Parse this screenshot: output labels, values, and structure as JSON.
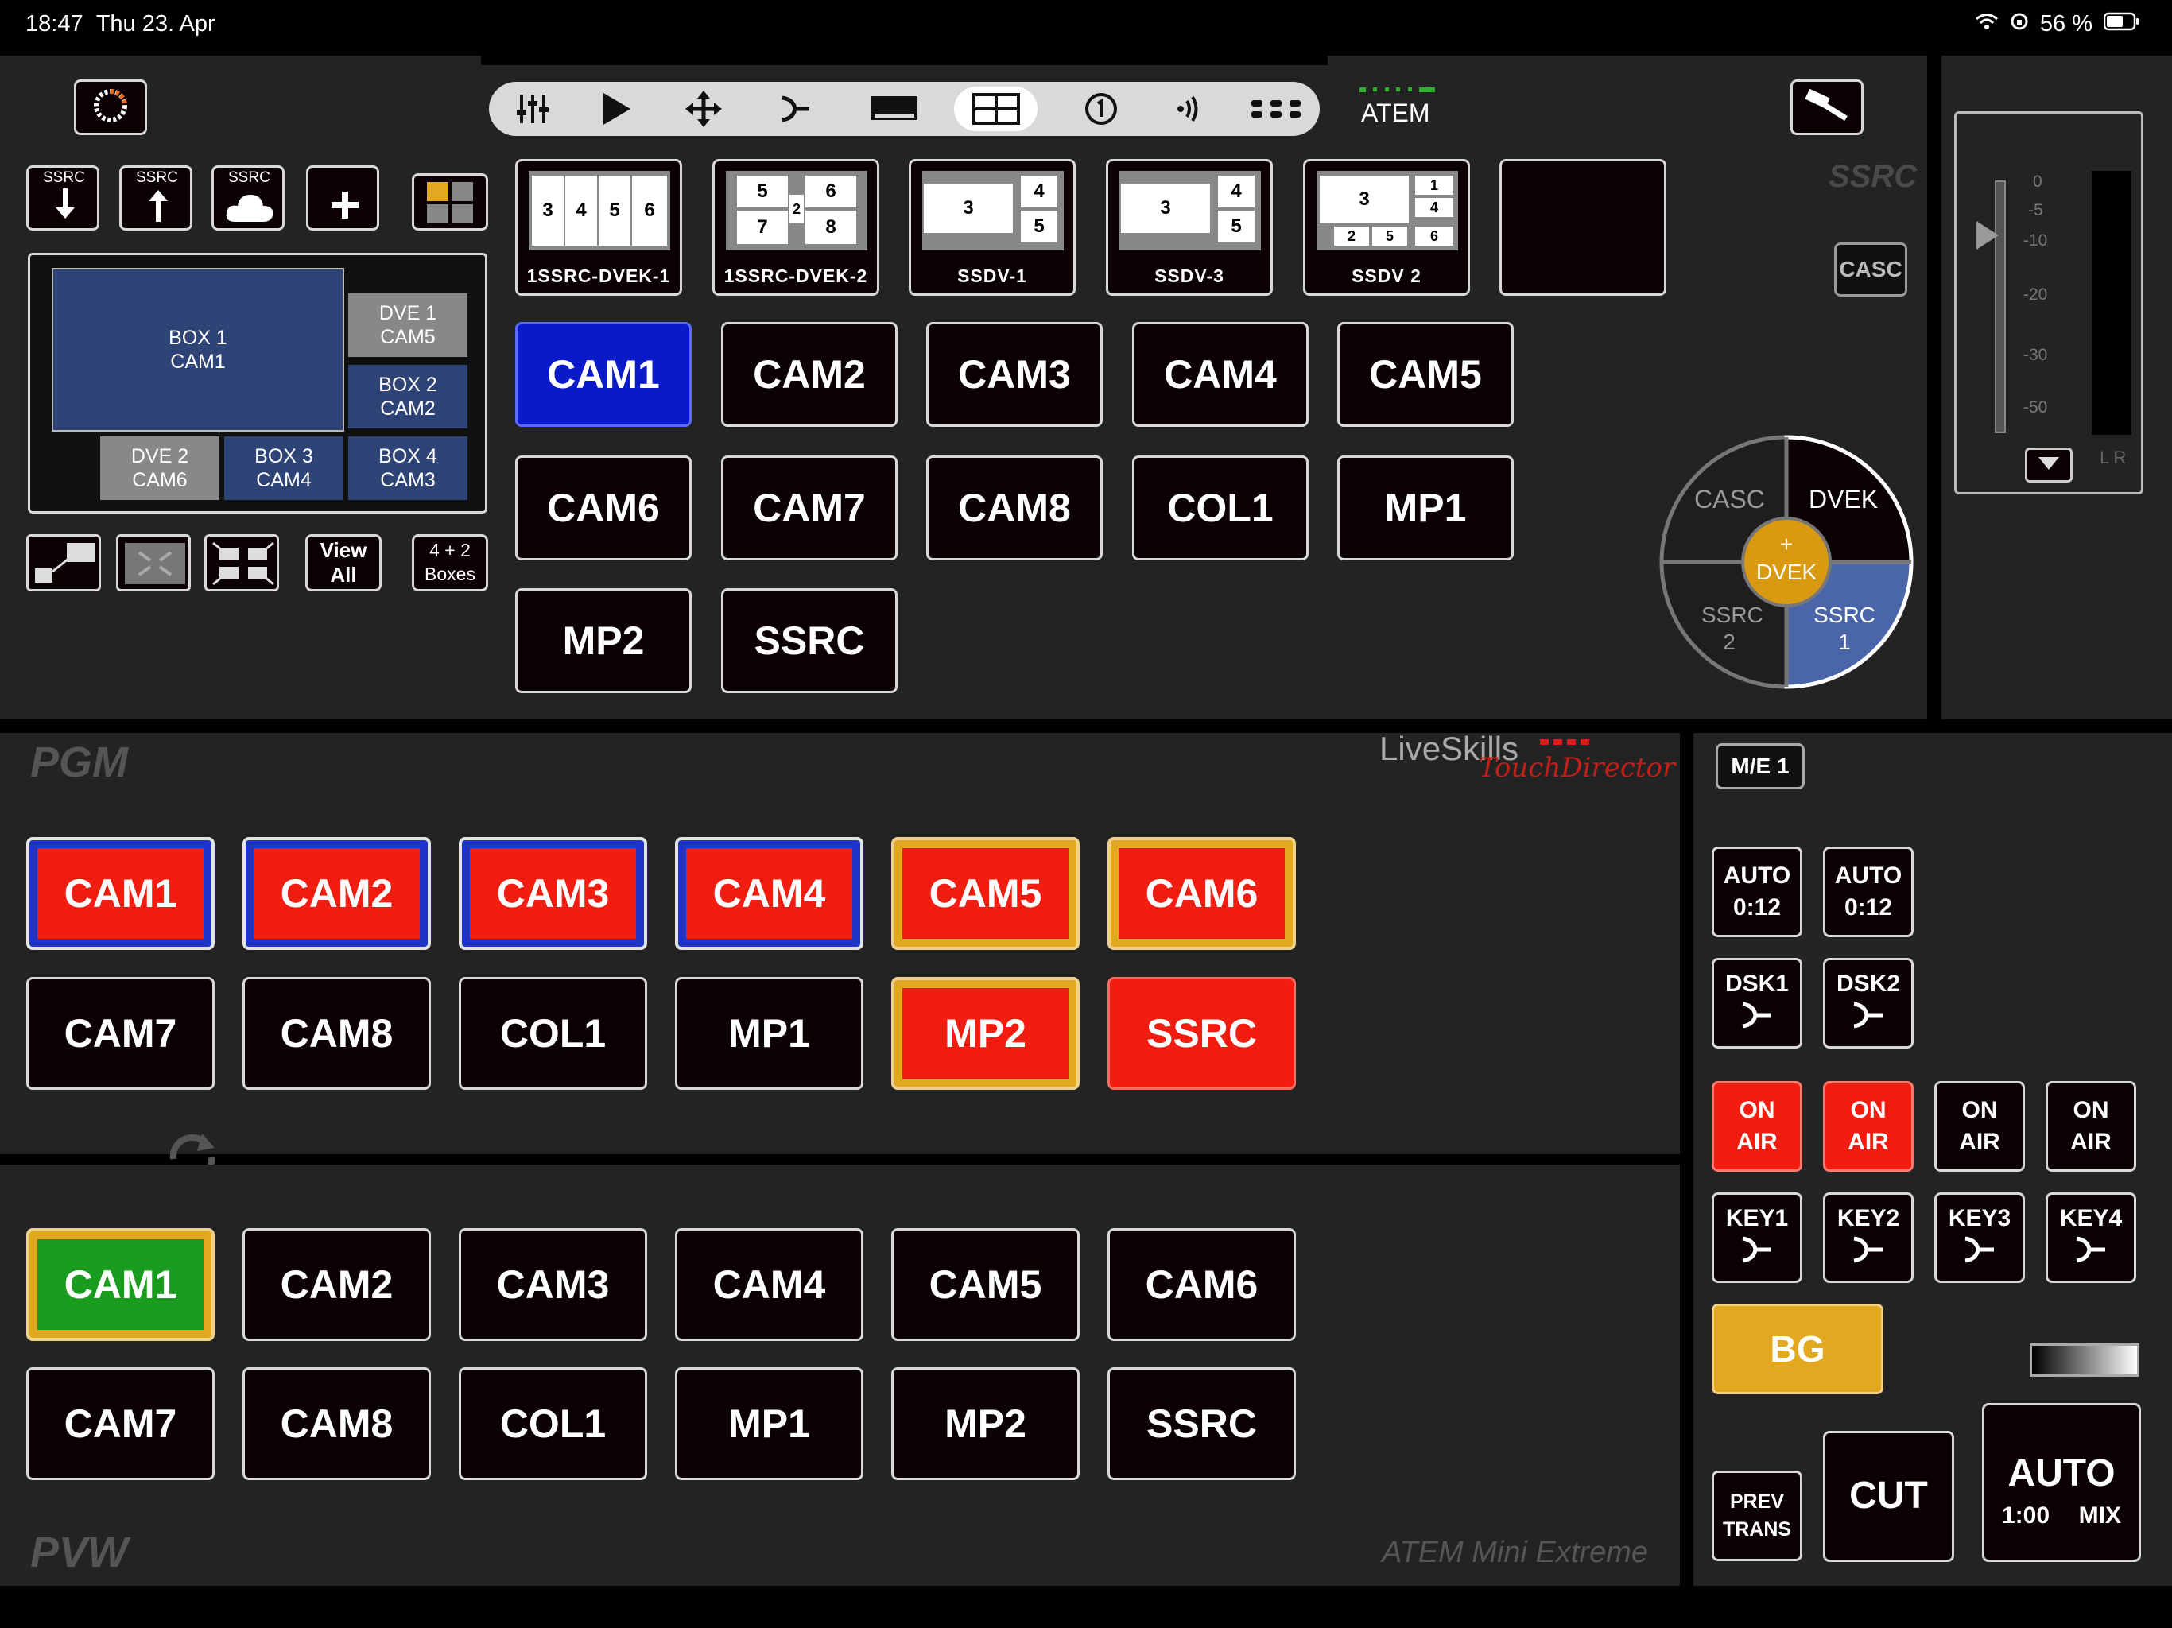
{
  "status": {
    "time": "18:47",
    "date": "Thu 23. Apr",
    "battery": "56 %"
  },
  "atem_label": "ATEM",
  "ssrc_header": "SSRC",
  "casc_button": "CASC",
  "toolbar": {
    "icons": [
      "sliders-icon",
      "play-icon",
      "move-icon",
      "transition-icon",
      "keyer-icon",
      "ssrc-layout-icon",
      "number-one-icon",
      "audio-icon",
      "dots-grid-icon"
    ]
  },
  "ssrc_tools": {
    "download_label": "SSRC",
    "upload_label": "SSRC",
    "cloud_label": "SSRC"
  },
  "layout_boxes": {
    "box1": "BOX 1\nCAM1",
    "dve1": "DVE 1\nCAM5",
    "box2": "BOX 2\nCAM2",
    "dve2": "DVE 2\nCAM6",
    "box3": "BOX 3\nCAM4",
    "box4": "BOX 4\nCAM3"
  },
  "layout_tools": {
    "view_all": "View\nAll",
    "boxes": "4 + 2\nBoxes"
  },
  "presets": [
    {
      "label": "1SSRC-DVEK-1",
      "cells": [
        "3",
        "4",
        "5",
        "6"
      ]
    },
    {
      "label": "1SSRC-DVEK-2",
      "cells": [
        "5",
        "6",
        "7",
        "8",
        "2"
      ]
    },
    {
      "label": "SSDV-1",
      "cells": [
        "3",
        "4",
        "5"
      ]
    },
    {
      "label": "SSDV-3",
      "cells": [
        "3",
        "4",
        "5"
      ]
    },
    {
      "label": "SSDV 2",
      "cells": [
        "3",
        "1",
        "4",
        "2",
        "5",
        "6"
      ]
    }
  ],
  "ssrc_sources": [
    "CAM1",
    "CAM2",
    "CAM3",
    "CAM4",
    "CAM5",
    "CAM6",
    "CAM7",
    "CAM8",
    "COL1",
    "MP1",
    "MP2",
    "SSRC"
  ],
  "dial": {
    "casc": "CASC",
    "dvek": "DVEK",
    "center": "+\nDVEK",
    "ssrc2": "SSRC\n2",
    "ssrc1": "SSRC\n1"
  },
  "meter": {
    "scale": [
      "0",
      "-5",
      "-10",
      "-20",
      "-30",
      "-50"
    ],
    "lr": "L R"
  },
  "pgm": {
    "title": "PGM",
    "buttons": [
      "CAM1",
      "CAM2",
      "CAM3",
      "CAM4",
      "CAM5",
      "CAM6",
      "CAM7",
      "CAM8",
      "COL1",
      "MP1",
      "MP2",
      "SSRC"
    ]
  },
  "pvw": {
    "title": "PVW",
    "buttons": [
      "CAM1",
      "CAM2",
      "CAM3",
      "CAM4",
      "CAM5",
      "CAM6",
      "CAM7",
      "CAM8",
      "COL1",
      "MP1",
      "MP2",
      "SSRC"
    ]
  },
  "brand": {
    "name": "LiveSkills",
    "sub": "TouchDirector",
    "device": "ATEM Mini Extreme"
  },
  "me": {
    "title": "M/E 1",
    "auto1": "AUTO\n0:12",
    "auto2": "AUTO\n0:12",
    "dsk1": "DSK1",
    "dsk2": "DSK2",
    "onair": [
      "ON\nAIR",
      "ON\nAIR",
      "ON\nAIR",
      "ON\nAIR"
    ],
    "keys": [
      "KEY1",
      "KEY2",
      "KEY3",
      "KEY4"
    ],
    "bg": "BG",
    "prev_trans": "PREV\nTRANS",
    "cut": "CUT",
    "auto": "AUTO",
    "auto_rate": "1:00",
    "auto_mix": "MIX"
  },
  "colors": {
    "program_red": "#f01d10",
    "preview_green": "#1a9c1e",
    "selected_blue": "#0a1ac8",
    "tally_gold": "#e2a820"
  }
}
